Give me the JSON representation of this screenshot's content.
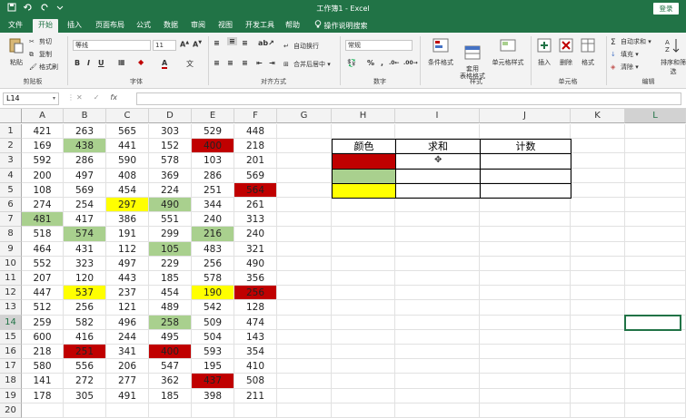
{
  "titlebar": {
    "title": "工作簿1 - Excel",
    "login": "登录",
    "save_icon": "save-icon",
    "undo_icon": "undo-icon",
    "redo_icon": "redo-icon"
  },
  "tabs": [
    "文件",
    "开始",
    "插入",
    "页面布局",
    "公式",
    "数据",
    "审阅",
    "视图",
    "开发工具",
    "帮助"
  ],
  "tell_me": "操作说明搜索",
  "active_tab": "开始",
  "ribbon": {
    "clipboard": {
      "label": "剪贴板",
      "paste": "粘贴",
      "cut": "剪切",
      "copy": "复制",
      "format_painter": "格式刷"
    },
    "font": {
      "label": "字体",
      "font_name": "等线",
      "font_size": "11"
    },
    "alignment": {
      "label": "对齐方式",
      "wrap": "自动换行",
      "merge": "合并后居中"
    },
    "number": {
      "label": "数字",
      "format": "常规"
    },
    "styles": {
      "label": "样式",
      "conditional": "条件格式",
      "table": "套用\n表格格式",
      "cell_styles": "单元格样式"
    },
    "cells": {
      "label": "单元格",
      "insert": "插入",
      "delete": "删除",
      "format": "格式"
    },
    "editing": {
      "label": "编辑",
      "autosum": "自动求和",
      "fill": "填充",
      "clear": "清除",
      "sort": "排序和筛选"
    }
  },
  "formula_bar": {
    "name_box": "L14",
    "fx": "fx",
    "content": ""
  },
  "columns": [
    "A",
    "B",
    "C",
    "D",
    "E",
    "F",
    "G",
    "H",
    "I",
    "J",
    "K",
    "L"
  ],
  "rows": [
    "1",
    "2",
    "3",
    "4",
    "5",
    "6",
    "7",
    "8",
    "9",
    "10",
    "11",
    "12",
    "13",
    "14",
    "15",
    "16",
    "17",
    "18",
    "19",
    "20"
  ],
  "colors": {
    "red": "#c00000",
    "green": "#a9d08e",
    "yellow": "#ffff00",
    "excel_green": "#217346"
  },
  "data": [
    [
      "421",
      "263",
      "565",
      "303",
      "529",
      "448"
    ],
    [
      "169",
      "438",
      "441",
      "152",
      "400",
      "218"
    ],
    [
      "592",
      "286",
      "590",
      "578",
      "103",
      "201"
    ],
    [
      "200",
      "497",
      "408",
      "369",
      "286",
      "569"
    ],
    [
      "108",
      "569",
      "454",
      "224",
      "251",
      "564"
    ],
    [
      "274",
      "254",
      "297",
      "490",
      "344",
      "261"
    ],
    [
      "481",
      "417",
      "386",
      "551",
      "240",
      "313"
    ],
    [
      "518",
      "574",
      "191",
      "299",
      "216",
      "240"
    ],
    [
      "464",
      "431",
      "112",
      "105",
      "483",
      "321"
    ],
    [
      "552",
      "323",
      "497",
      "229",
      "256",
      "490"
    ],
    [
      "207",
      "120",
      "443",
      "185",
      "578",
      "356"
    ],
    [
      "447",
      "537",
      "237",
      "454",
      "190",
      "256"
    ],
    [
      "512",
      "256",
      "121",
      "489",
      "542",
      "128"
    ],
    [
      "259",
      "582",
      "496",
      "258",
      "509",
      "474"
    ],
    [
      "600",
      "416",
      "244",
      "495",
      "504",
      "143"
    ],
    [
      "218",
      "251",
      "341",
      "400",
      "593",
      "354"
    ],
    [
      "580",
      "556",
      "206",
      "547",
      "195",
      "410"
    ],
    [
      "141",
      "272",
      "277",
      "362",
      "437",
      "508"
    ],
    [
      "178",
      "305",
      "491",
      "185",
      "398",
      "211"
    ]
  ],
  "cell_fills": [
    {
      "r": 1,
      "c": 1,
      "fill": "green"
    },
    {
      "r": 1,
      "c": 4,
      "fill": "red"
    },
    {
      "r": 4,
      "c": 5,
      "fill": "red"
    },
    {
      "r": 5,
      "c": 2,
      "fill": "yellow"
    },
    {
      "r": 5,
      "c": 3,
      "fill": "green"
    },
    {
      "r": 6,
      "c": 0,
      "fill": "green"
    },
    {
      "r": 7,
      "c": 1,
      "fill": "green"
    },
    {
      "r": 7,
      "c": 4,
      "fill": "green"
    },
    {
      "r": 8,
      "c": 3,
      "fill": "green"
    },
    {
      "r": 11,
      "c": 1,
      "fill": "yellow"
    },
    {
      "r": 11,
      "c": 4,
      "fill": "yellow"
    },
    {
      "r": 11,
      "c": 5,
      "fill": "red"
    },
    {
      "r": 13,
      "c": 3,
      "fill": "green"
    },
    {
      "r": 15,
      "c": 1,
      "fill": "red"
    },
    {
      "r": 15,
      "c": 3,
      "fill": "red"
    },
    {
      "r": 17,
      "c": 4,
      "fill": "red"
    }
  ],
  "summary_table": {
    "headers": [
      "颜色",
      "求和",
      "计数"
    ],
    "rows": [
      {
        "color": "red"
      },
      {
        "color": "green"
      },
      {
        "color": "yellow"
      }
    ]
  },
  "selected_cell": "L14"
}
